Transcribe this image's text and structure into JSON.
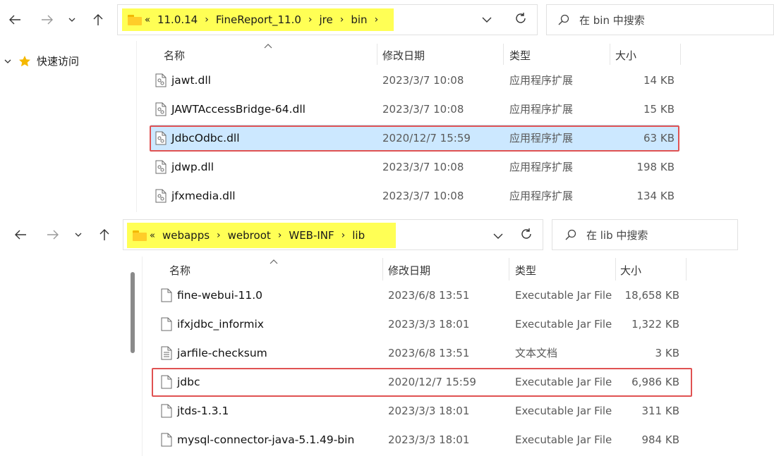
{
  "window1": {
    "address": {
      "overflow": "«",
      "crumbs": [
        "11.0.14",
        "FineReport_11.0",
        "jre",
        "bin"
      ]
    },
    "search_placeholder": "在 bin 中搜索",
    "columns": {
      "name": "名称",
      "date": "修改日期",
      "type": "类型",
      "size": "大小"
    },
    "files": [
      {
        "name": "jawt.dll",
        "date": "2023/3/7 10:08",
        "type": "应用程序扩展",
        "size": "14 KB"
      },
      {
        "name": "JAWTAccessBridge-64.dll",
        "date": "2023/3/7 10:08",
        "type": "应用程序扩展",
        "size": "15 KB"
      },
      {
        "name": "JdbcOdbc.dll",
        "date": "2020/12/7 15:59",
        "type": "应用程序扩展",
        "size": "63 KB"
      },
      {
        "name": "jdwp.dll",
        "date": "2023/3/7 10:08",
        "type": "应用程序扩展",
        "size": "198 KB"
      },
      {
        "name": "jfxmedia.dll",
        "date": "2023/3/7 10:08",
        "type": "应用程序扩展",
        "size": "134 KB"
      }
    ],
    "sidebar": {
      "quick_access": "快速访问"
    }
  },
  "window2": {
    "address": {
      "overflow": "«",
      "crumbs": [
        "webapps",
        "webroot",
        "WEB-INF",
        "lib"
      ]
    },
    "search_placeholder": "在 lib 中搜索",
    "columns": {
      "name": "名称",
      "date": "修改日期",
      "type": "类型",
      "size": "大小"
    },
    "files": [
      {
        "name": "fine-webui-11.0",
        "date": "2023/6/8 13:51",
        "type": "Executable Jar File",
        "size": "18,658 KB"
      },
      {
        "name": "ifxjdbc_informix",
        "date": "2023/3/3 18:01",
        "type": "Executable Jar File",
        "size": "1,322 KB"
      },
      {
        "name": "jarfile-checksum",
        "date": "2023/6/8 13:51",
        "type": "文本文档",
        "size": "3 KB"
      },
      {
        "name": "jdbc",
        "date": "2020/12/7 15:59",
        "type": "Executable Jar File",
        "size": "6,986 KB"
      },
      {
        "name": "jtds-1.3.1",
        "date": "2023/3/3 18:01",
        "type": "Executable Jar File",
        "size": "311 KB"
      },
      {
        "name": "mysql-connector-java-5.1.49-bin",
        "date": "2023/3/3 18:01",
        "type": "Executable Jar File",
        "size": "984 KB"
      }
    ]
  },
  "colors": {
    "highlight": "#ffff55",
    "selection": "#cce8ff",
    "annotation_box": "#e05252"
  }
}
